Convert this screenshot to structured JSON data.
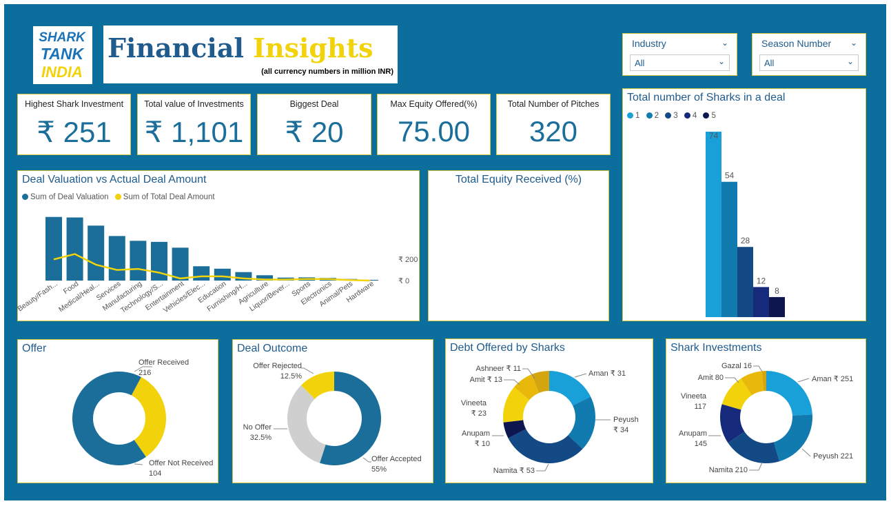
{
  "header": {
    "logo_text": [
      "SHARK",
      "TANK",
      "INDIA"
    ],
    "title_word1": "Financial",
    "title_word2": "Insights",
    "subtitle": "(all currency numbers in million INR)"
  },
  "slicers": [
    {
      "label": "Industry",
      "value": "All"
    },
    {
      "label": "Season Number",
      "value": "All"
    }
  ],
  "kpis": [
    {
      "label": "Highest Shark Investment",
      "value": "₹ 251"
    },
    {
      "label": "Total value of Investments",
      "value": "₹ 1,101"
    },
    {
      "label": "Biggest Deal",
      "value": "₹ 20"
    },
    {
      "label": "Max Equity Offered(%)",
      "value": "75.00"
    },
    {
      "label": "Total Number of Pitches",
      "value": "320"
    }
  ],
  "valuation": {
    "title": "Deal Valuation vs Actual Deal Amount",
    "legend": [
      "Sum of Deal Valuation",
      "Sum of Total Deal Amount"
    ],
    "y_ticks": [
      "₹ 200",
      "₹ 0"
    ]
  },
  "equity": {
    "title": "Total Equity Received (%)"
  },
  "sharks_count": {
    "title": "Total number of Sharks in a deal",
    "legend": [
      "1",
      "2",
      "3",
      "4",
      "5"
    ]
  },
  "offer": {
    "title": "Offer",
    "labels": [
      {
        "name": "Offer Received",
        "value": "216"
      },
      {
        "name": "Offer Not Received",
        "value": "104"
      }
    ]
  },
  "outcome": {
    "title": "Deal Outcome",
    "labels": [
      {
        "name": "Offer Rejected",
        "value": "12.5%"
      },
      {
        "name": "No Offer",
        "value": "32.5%"
      },
      {
        "name": "Offer Accepted",
        "value": "55%"
      }
    ]
  },
  "debt": {
    "title": "Debt Offered by Sharks",
    "labels": [
      {
        "name": "Ashneer ₹ 11"
      },
      {
        "name": "Amit ₹ 13"
      },
      {
        "name": "Vineeta",
        "value": "₹ 23"
      },
      {
        "name": "Anupam",
        "value": "₹ 10"
      },
      {
        "name": "Namita ₹ 53"
      },
      {
        "name": "Peyush",
        "value": "₹ 34"
      },
      {
        "name": "Aman ₹ 31"
      }
    ]
  },
  "investments": {
    "title": "Shark Investments",
    "labels": [
      {
        "name": "Gazal 16"
      },
      {
        "name": "Amit 80"
      },
      {
        "name": "Vineeta",
        "value": "117"
      },
      {
        "name": "Anupam",
        "value": "145"
      },
      {
        "name": "Namita 210"
      },
      {
        "name": "Peyush 221"
      },
      {
        "name": "Aman ₹ 251"
      }
    ]
  },
  "colors": {
    "background": "#0b6e9c",
    "teal": "#1a6e99",
    "yellow": "#f2d20a",
    "light_blue": "#1aa0d8",
    "dark_blue": "#123c7a",
    "navy": "#0f1a5c",
    "gray": "#cfcfcf"
  },
  "chart_data": [
    {
      "type": "bar",
      "title": "Deal Valuation vs Actual Deal Amount",
      "categories": [
        "Beauty/Fash...",
        "Food",
        "Medical/Heal...",
        "Services",
        "Manufacturing",
        "Technology/S...",
        "Entertainment",
        "Vehicles/Elec...",
        "Education",
        "Furnishing/H...",
        "Agriculture",
        "Liquor/Bever...",
        "Sports",
        "Electronics",
        "Animal/Pets",
        "Hardware"
      ],
      "series": [
        {
          "name": "Sum of Deal Valuation",
          "type": "bar",
          "values": [
            600,
            595,
            518,
            420,
            375,
            365,
            310,
            135,
            112,
            80,
            50,
            28,
            30,
            25,
            15,
            7
          ]
        },
        {
          "name": "Sum of Total Deal Amount",
          "type": "line",
          "values": [
            200,
            250,
            150,
            100,
            110,
            75,
            20,
            40,
            40,
            20,
            10,
            10,
            15,
            15,
            5,
            0
          ]
        }
      ],
      "ylim": [
        0,
        650
      ],
      "y_ticks": [
        0,
        200
      ]
    },
    {
      "type": "bar",
      "title": "Total number of Sharks in a deal",
      "categories": [
        "1",
        "2",
        "3",
        "4",
        "5"
      ],
      "values": [
        74,
        54,
        28,
        12,
        8
      ],
      "ylim": [
        0,
        74
      ]
    },
    {
      "type": "pie",
      "title": "Offer",
      "categories": [
        "Offer Received",
        "Offer Not Received"
      ],
      "values": [
        216,
        104
      ]
    },
    {
      "type": "pie",
      "title": "Deal Outcome",
      "categories": [
        "Offer Accepted",
        "No Offer",
        "Offer Rejected"
      ],
      "values": [
        55,
        32.5,
        12.5
      ]
    },
    {
      "type": "pie",
      "title": "Debt Offered by Sharks",
      "categories": [
        "Aman",
        "Peyush",
        "Namita",
        "Anupam",
        "Vineeta",
        "Amit",
        "Ashneer"
      ],
      "values": [
        31,
        34,
        53,
        10,
        23,
        13,
        11
      ]
    },
    {
      "type": "pie",
      "title": "Shark Investments",
      "categories": [
        "Aman",
        "Peyush",
        "Namita",
        "Anupam",
        "Vineeta",
        "Amit",
        "Gazal"
      ],
      "values": [
        251,
        221,
        210,
        145,
        117,
        80,
        16
      ]
    }
  ]
}
